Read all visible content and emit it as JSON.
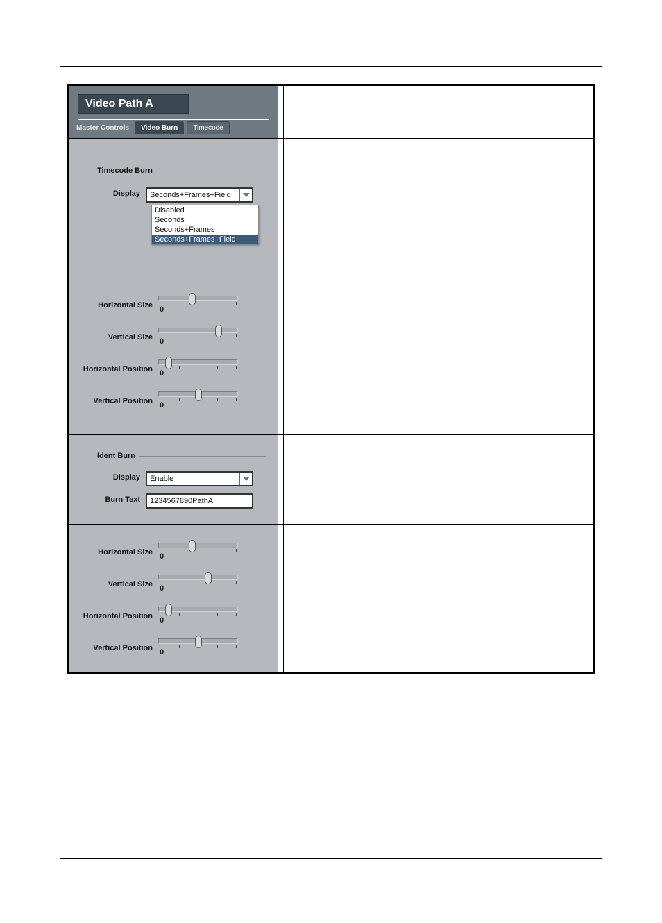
{
  "header": {
    "title": "Video Path A",
    "tabs": [
      "Master Controls",
      "Video Burn",
      "Timecode"
    ]
  },
  "timecode_burn": {
    "section": "Timecode Burn",
    "display_label": "Display",
    "selected": "Seconds+Frames+Field",
    "options": [
      "Disabled",
      "Seconds",
      "Seconds+Frames",
      "Seconds+Frames+Field"
    ]
  },
  "sliders1": {
    "hsize": {
      "label": "Horizontal Size",
      "value": "0",
      "thumb_pct": 38
    },
    "vsize": {
      "label": "Vertical Size",
      "value": "0",
      "thumb_pct": 72
    },
    "hpos": {
      "label": "Horizontal Position",
      "value": "0",
      "thumb_pct": 8
    },
    "vpos": {
      "label": "Vertical Position",
      "value": "0",
      "thumb_pct": 46
    }
  },
  "ident": {
    "section": "Ident Burn",
    "display_label": "Display",
    "display_value": "Enable",
    "burn_text_label": "Burn Text",
    "burn_text_value": "1234567890PathA"
  },
  "sliders2": {
    "hsize": {
      "label": "Horizontal Size",
      "value": "0",
      "thumb_pct": 38
    },
    "vsize": {
      "label": "Vertical Size",
      "value": "0",
      "thumb_pct": 58
    },
    "hpos": {
      "label": "Horizontal Position",
      "value": "0",
      "thumb_pct": 8
    },
    "vpos": {
      "label": "Vertical Position",
      "value": "0",
      "thumb_pct": 46
    }
  }
}
